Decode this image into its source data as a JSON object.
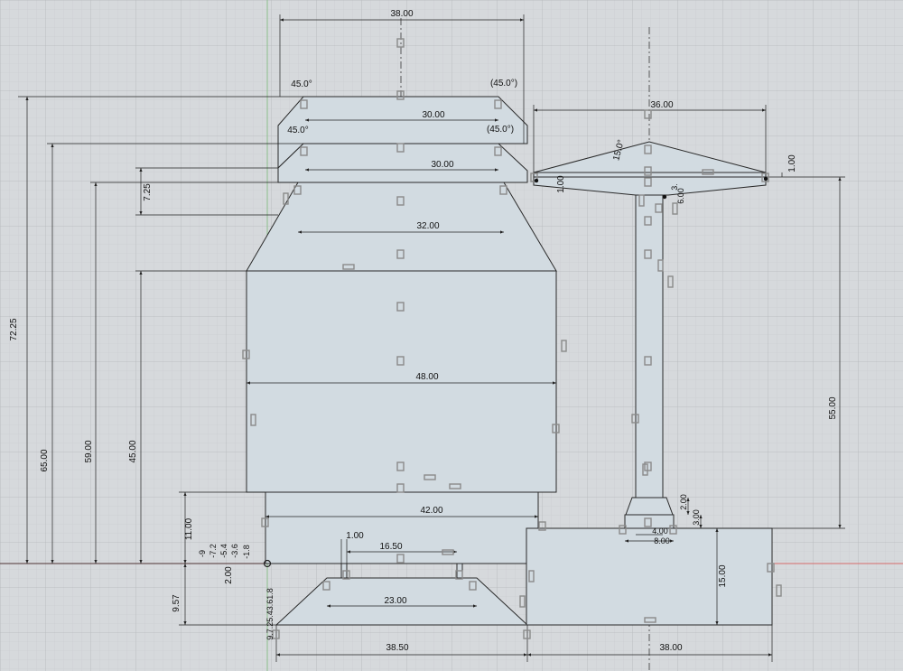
{
  "diagram": {
    "colors": {
      "background": "#d6d9dc",
      "grid_minor": "#c7cacd",
      "grid_major": "#b5b8bb",
      "fill": "#d2dbe1",
      "line": "#2a2a2a",
      "axis_red": "#d66a6a",
      "axis_green": "#8cc08c",
      "constraint_icon": "#8a8a8a"
    },
    "dimensions": {
      "top_width": "38.00",
      "chamfer_left_1": "45.0°",
      "chamfer_right_1": "(45.0°)",
      "width_30_top": "30.00",
      "chamfer_left_2": "45.0°",
      "chamfer_right_2": "(45.0°)",
      "width_30_second": "30.00",
      "width_32": "32.00",
      "height_7_25": "7.25",
      "width_48": "48.00",
      "width_42": "42.00",
      "height_72_25": "72.25",
      "height_65": "65.00",
      "height_59": "59.00",
      "height_45": "45.00",
      "height_11": "11.00",
      "width_1_00_bottom": "1.00",
      "width_16_50": "16.50",
      "width_23": "23.00",
      "height_9_57": "9.57",
      "height_2_00_bottom": "2.00",
      "width_38_50": "38.50",
      "width_38_bottom": "38.00",
      "cap_width_36": "36.00",
      "cap_angle_15": "15.0°",
      "cap_height_1_right": "1.00",
      "cap_height_1_left": "1.00",
      "post_w_3": "3.",
      "post_w_6": "6.00",
      "post_h_55": "55.00",
      "base_height_15": "15.00",
      "collar_2": "2.00",
      "collar_3": "3.00",
      "collar_4": "4.00",
      "collar_8": "8.00",
      "neg_values": [
        "-9",
        "-7.2",
        "-5.4",
        "-3.6",
        "-1.8"
      ],
      "pos_values": "9.7.25.43.61.8"
    }
  }
}
